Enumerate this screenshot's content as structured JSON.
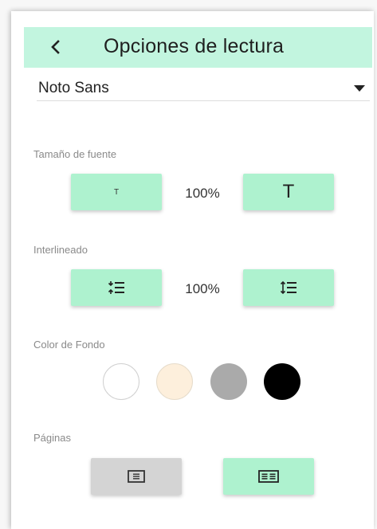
{
  "header": {
    "back_icon": "chevron-left-icon",
    "title": "Opciones de lectura",
    "background": "#c2f5df"
  },
  "font_select": {
    "value": "Noto Sans",
    "caret_icon": "caret-down-icon"
  },
  "font_size": {
    "label": "Tamaño de fuente",
    "decrease_label": "T",
    "increase_label": "T",
    "value": "100%"
  },
  "line_height": {
    "label": "Interlineado",
    "decrease_icon": "line-spacing-decrease-icon",
    "increase_icon": "line-spacing-increase-icon",
    "value": "100%"
  },
  "background_color": {
    "label": "Color de Fondo",
    "options": [
      {
        "name": "white",
        "color": "#ffffff"
      },
      {
        "name": "sepia",
        "color": "#fdefdc"
      },
      {
        "name": "gray",
        "color": "#aaaaaa"
      },
      {
        "name": "black",
        "color": "#000000"
      }
    ]
  },
  "pages": {
    "label": "Páginas",
    "single_icon": "single-page-icon",
    "double_icon": "double-page-icon"
  },
  "colors": {
    "accent": "#aef2cf",
    "header": "#c2f5df",
    "inactive": "#d4d4d4"
  }
}
